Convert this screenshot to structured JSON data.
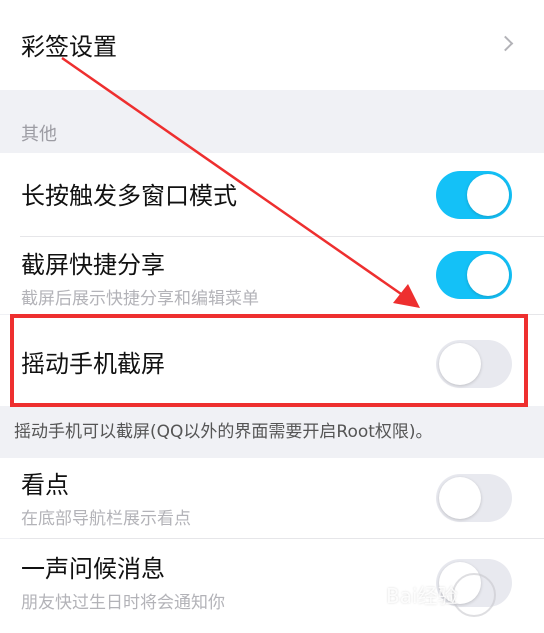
{
  "rows": {
    "caiqian": {
      "label": "彩签设置"
    },
    "section_other": {
      "title": "其他"
    },
    "long_press": {
      "label": "长按触发多窗口模式",
      "enabled": true
    },
    "screenshot_share": {
      "label": "截屏快捷分享",
      "subtitle": "截屏后展示快捷分享和编辑菜单",
      "enabled": true
    },
    "shake_screenshot": {
      "label": "摇动手机截屏",
      "enabled": false
    },
    "shake_note": "摇动手机可以截屏(QQ以外的界面需要开启Root权限)。",
    "kandian": {
      "label": "看点",
      "subtitle": "在底部导航栏展示看点",
      "enabled": false
    },
    "greeting": {
      "label": "一声问候消息",
      "subtitle": "朋友快过生日时将会通知你",
      "enabled": false
    }
  },
  "watermark": "Bai经验",
  "colors": {
    "toggle_on": "#14c1f7",
    "toggle_off": "#e8e9ef",
    "annotation_red": "#ee2f2f"
  },
  "icons": {
    "chevron": "chevron-right-icon"
  }
}
